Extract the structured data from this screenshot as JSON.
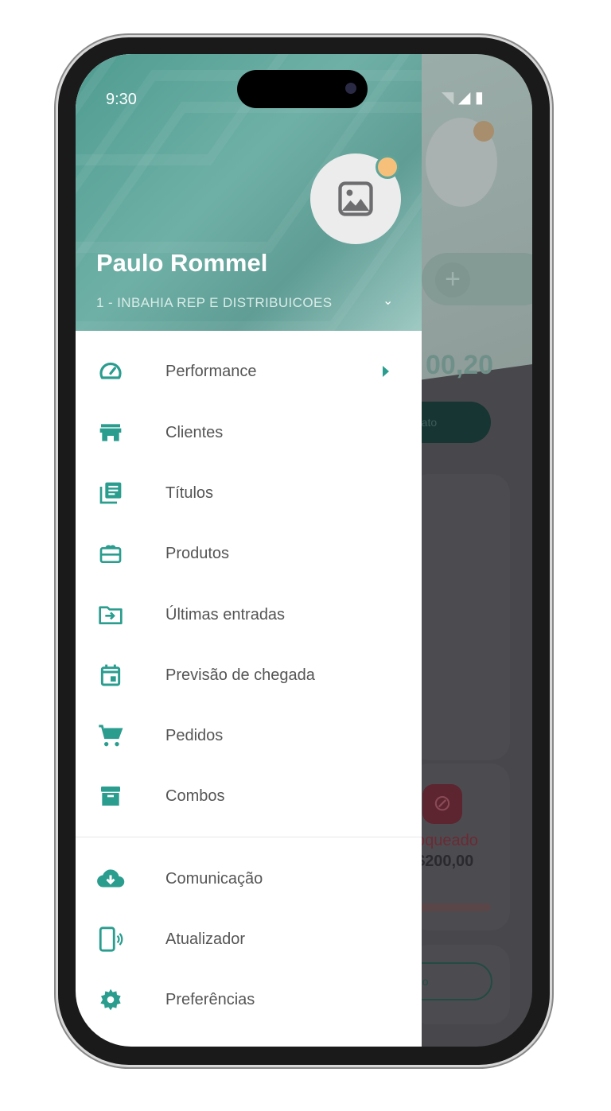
{
  "status_bar": {
    "time": "9:30"
  },
  "drawer": {
    "user_name": "Paulo Rommel",
    "company": "1 - INBAHIA REP E DISTRIBUICOES",
    "menu": [
      {
        "label": "Performance",
        "icon": "speedometer-icon"
      },
      {
        "label": "Clientes",
        "icon": "store-icon"
      },
      {
        "label": "Títulos",
        "icon": "document-list-icon"
      },
      {
        "label": "Produtos",
        "icon": "gift-box-icon"
      },
      {
        "label": "Últimas entradas",
        "icon": "folder-arrow-icon"
      },
      {
        "label": "Previsão de chegada",
        "icon": "calendar-icon"
      },
      {
        "label": "Pedidos",
        "icon": "cart-icon"
      },
      {
        "label": "Combos",
        "icon": "archive-icon"
      }
    ],
    "menu_secondary": [
      {
        "label": "Comunicação",
        "icon": "cloud-download-icon"
      },
      {
        "label": "Atualizador",
        "icon": "phone-update-icon"
      },
      {
        "label": "Preferências",
        "icon": "gear-icon"
      }
    ]
  },
  "background": {
    "amount": "00,20",
    "button": "rato",
    "blocked_label": "oqueado",
    "blocked_value": "$200,00",
    "outline_button": "do"
  },
  "colors": {
    "accent": "#2a9d8f",
    "avatar_badge": "#f7c07a"
  }
}
